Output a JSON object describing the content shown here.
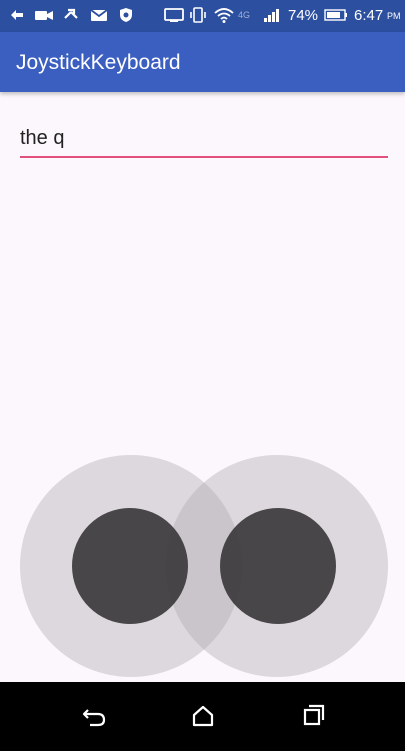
{
  "status_bar": {
    "network_label": "4G",
    "battery_percent": "74%",
    "time": "6:47",
    "time_suffix": "PM",
    "icons": [
      "back-arrow-icon",
      "video-icon",
      "usb-icon",
      "mail-icon",
      "shield-icon",
      "cast-icon",
      "vibrate-icon",
      "wifi-icon",
      "signal-icon",
      "battery-icon"
    ]
  },
  "app_bar": {
    "title": "JoystickKeyboard",
    "color": "#3b5fc0"
  },
  "edit_field": {
    "value": "the q",
    "underline_color": "#e2507e"
  },
  "joysticks": [
    {
      "name": "left-joystick"
    },
    {
      "name": "right-joystick"
    }
  ],
  "nav_bar": {
    "icons": [
      "back-icon",
      "home-icon",
      "recents-icon"
    ]
  }
}
